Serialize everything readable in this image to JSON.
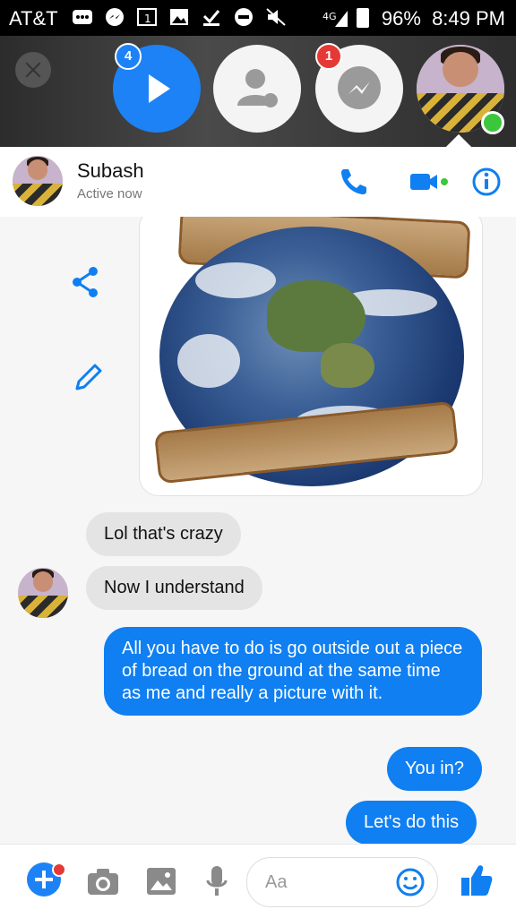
{
  "status_bar": {
    "carrier": "AT&T",
    "battery": "96%",
    "time": "8:49 PM",
    "network": "4G LTE"
  },
  "chat_heads": {
    "video_badge": "4",
    "messenger_badge": "1"
  },
  "header": {
    "name": "Subash",
    "status": "Active now"
  },
  "messages": [
    {
      "direction": "in",
      "text": "Lol that's crazy"
    },
    {
      "direction": "in",
      "text": "Now I understand"
    },
    {
      "direction": "out",
      "text": "All you have to do is go outside out a piece of bread on the ground at the same time as me and really a picture with it."
    },
    {
      "direction": "out",
      "text": "You in?"
    },
    {
      "direction": "out",
      "text": "Let's do this"
    }
  ],
  "composer": {
    "placeholder": "Aa"
  },
  "colors": {
    "accent": "#0f7ff2",
    "online": "#3cc63c",
    "badge_red": "#e53935"
  }
}
